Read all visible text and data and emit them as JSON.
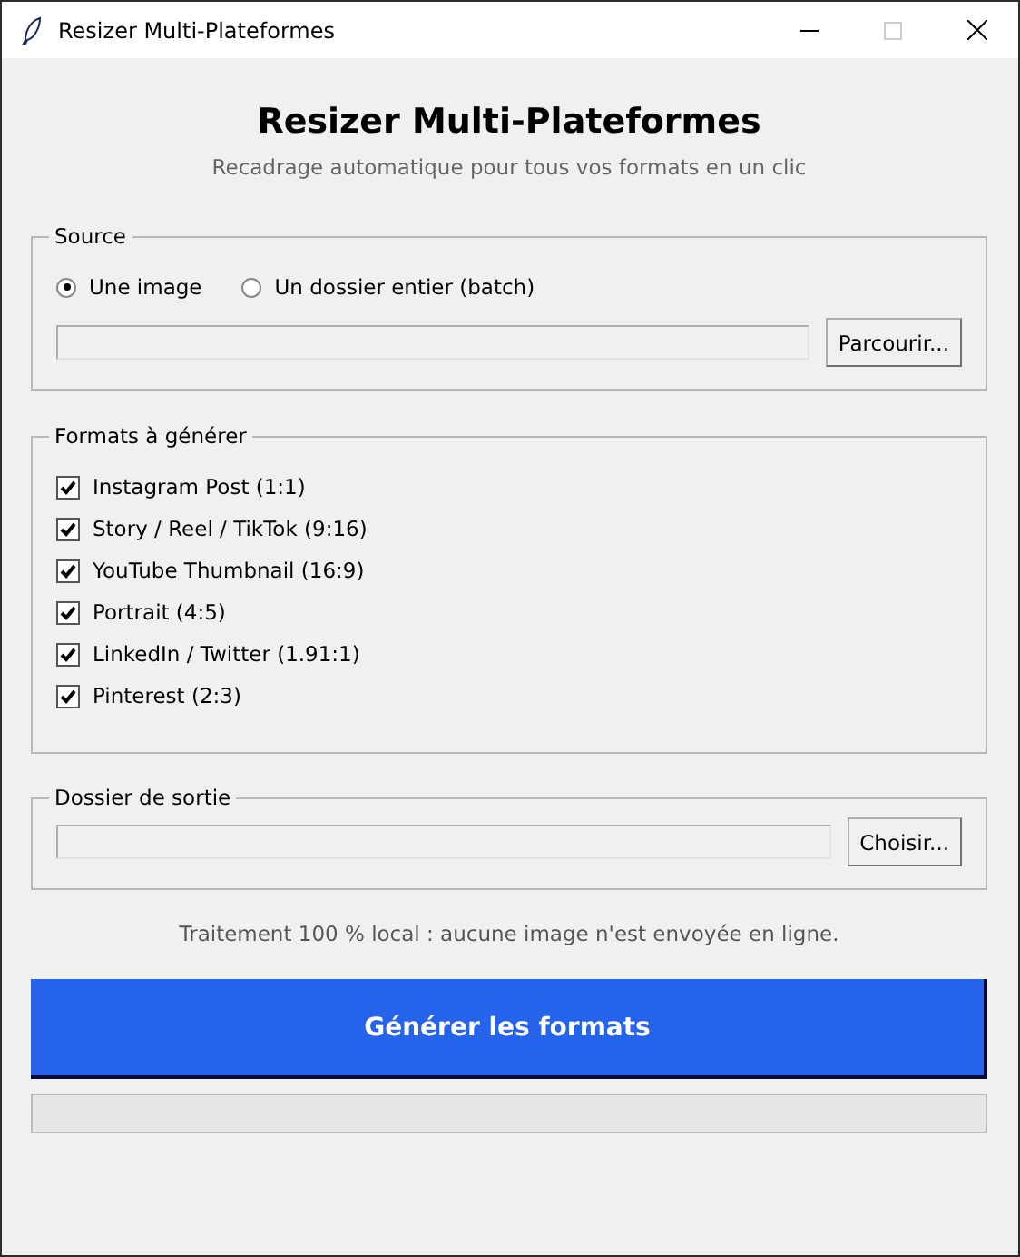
{
  "window": {
    "title": "Resizer Multi-Plateformes"
  },
  "header": {
    "title": "Resizer Multi-Plateformes",
    "subtitle": "Recadrage automatique pour tous vos formats en un clic"
  },
  "source": {
    "label": "Source",
    "options": [
      {
        "label": "Une image",
        "selected": true
      },
      {
        "label": "Un dossier entier (batch)",
        "selected": false
      }
    ],
    "browse_button": "Parcourir..."
  },
  "formats": {
    "label": "Formats à générer",
    "items": [
      {
        "label": "Instagram Post (1:1)",
        "checked": true
      },
      {
        "label": "Story / Reel / TikTok (9:16)",
        "checked": true
      },
      {
        "label": "YouTube Thumbnail (16:9)",
        "checked": true
      },
      {
        "label": "Portrait (4:5)",
        "checked": true
      },
      {
        "label": "LinkedIn / Twitter (1.91:1)",
        "checked": true
      },
      {
        "label": "Pinterest (2:3)",
        "checked": true
      }
    ]
  },
  "output": {
    "label": "Dossier de sortie",
    "choose_button": "Choisir..."
  },
  "note": "Traitement 100 % local : aucune image n'est envoyée en ligne.",
  "generate_button": "Générer les formats",
  "progress": {
    "level": 0
  }
}
